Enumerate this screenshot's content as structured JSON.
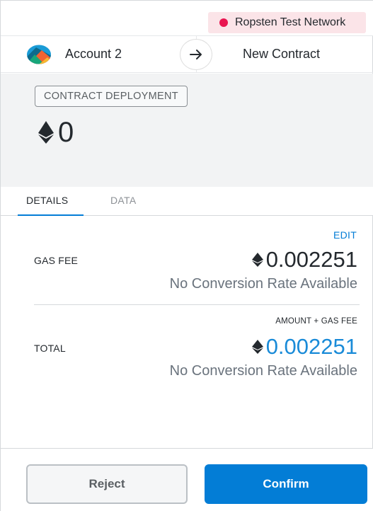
{
  "network": {
    "label": "Ropsten Test Network",
    "dot_color": "#e91550"
  },
  "sender": {
    "account_name": "Account 2",
    "avatar_icon": "identicon"
  },
  "recipient": {
    "label": "New Contract"
  },
  "summary": {
    "action_label": "CONTRACT DEPLOYMENT",
    "amount": "0",
    "currency_icon": "eth-icon"
  },
  "tabs": [
    {
      "label": "DETAILS",
      "active": true
    },
    {
      "label": "DATA",
      "active": false
    }
  ],
  "details": {
    "edit_label": "EDIT",
    "gas_fee": {
      "label": "GAS FEE",
      "amount": "0.002251",
      "conversion": "No Conversion Rate Available"
    },
    "total": {
      "hint": "AMOUNT + GAS FEE",
      "label": "TOTAL",
      "amount": "0.002251",
      "conversion": "No Conversion Rate Available"
    }
  },
  "footer": {
    "reject_label": "Reject",
    "confirm_label": "Confirm"
  },
  "colors": {
    "accent": "#037dd6",
    "total_amount": "#1a8bd8",
    "network_bg": "#fbe4e8"
  }
}
